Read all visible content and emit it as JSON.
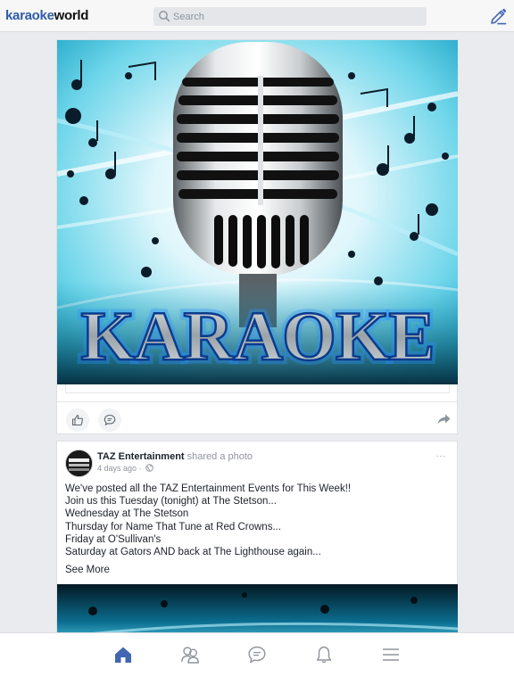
{
  "app": {
    "logo_part1": "karaoke",
    "logo_part2": "world",
    "brand_color": "#2f5da8"
  },
  "search": {
    "placeholder": "Search",
    "icon": "search-icon"
  },
  "header": {
    "compose_icon": "pencil-edit-icon"
  },
  "feed": {
    "post1": {
      "image_title": "KARAOKE",
      "actions": {
        "like_icon": "thumbs-up-icon",
        "comment_icon": "comment-bubble-icon",
        "share_icon": "share-arrow-icon"
      }
    },
    "post2": {
      "author": "TAZ Entertainment",
      "action": "shared a photo",
      "time": "4 days ago",
      "separator": "·",
      "privacy_icon": "globe-icon",
      "options": "···",
      "lines": [
        "We've posted all the TAZ Entertainment Events for This Week!!",
        "Join us this Tuesday (tonight) at The Stetson...",
        "Wednesday at The Stetson",
        "Thursday for Name That Tune at Red Crowns...",
        "Friday at O'Sullivan's",
        "Saturday at Gators AND back at The Lighthouse again..."
      ],
      "see_more": "See More"
    }
  },
  "tabbar": {
    "items": [
      {
        "name": "home",
        "icon": "home-icon",
        "active": true
      },
      {
        "name": "friends",
        "icon": "friends-icon",
        "active": false
      },
      {
        "name": "messages",
        "icon": "messages-icon",
        "active": false
      },
      {
        "name": "notifications",
        "icon": "bell-icon",
        "active": false
      },
      {
        "name": "menu",
        "icon": "menu-icon",
        "active": false
      }
    ],
    "active_color": "#4267b2",
    "inactive_color": "#90949c"
  }
}
